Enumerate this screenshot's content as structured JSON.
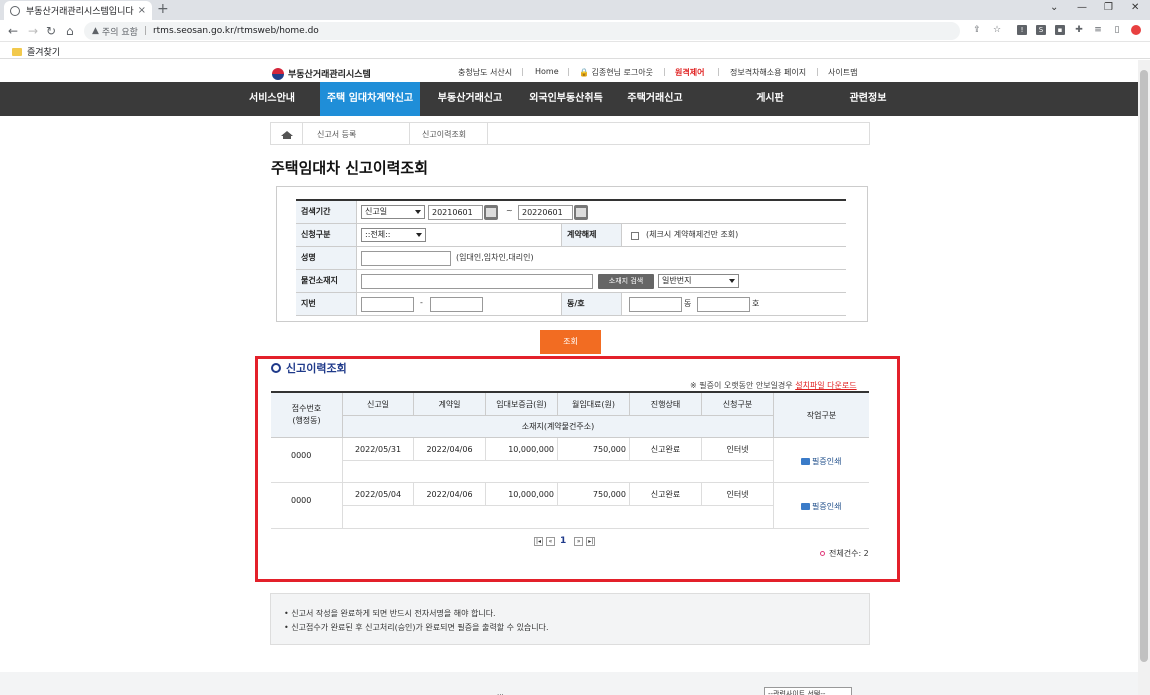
{
  "browser": {
    "tab_title": "부동산거래관리시스템입니다",
    "tab_close": "×",
    "new_tab": "+",
    "window_controls": [
      "⌄",
      "—",
      "❐",
      "✕"
    ],
    "security_label": "주의 요함",
    "url": "rtms.seosan.go.kr/rtmsweb/home.do",
    "bookmark": "즐겨찾기"
  },
  "header": {
    "logo_text": "부동산거래관리시스템",
    "region": "충청남도 서산시",
    "home": "Home",
    "user": "김종현님 로그아웃",
    "remote": "원격제어",
    "info_page": "정보격차해소용 페이지",
    "sitemap": "사이트맵"
  },
  "gnb": [
    "서비스안내",
    "주택 임대차계약신고",
    "부동산거래신고",
    "외국인부동산취득",
    "주택거래신고",
    "게시판",
    "관련정보"
  ],
  "breadcrumb": [
    "신고서 등록",
    "신고이력조회"
  ],
  "page_title": "주택임대차 신고이력조회",
  "form": {
    "period_label": "검색기간",
    "period_type": "신고일",
    "date_from": "20210601",
    "tilde": "~",
    "date_to": "20220601",
    "apply_type_label": "신청구분",
    "apply_type_value": "::전체::",
    "cancel_label": "계약해제",
    "cancel_note": "(체크시 계약해제건만 조회)",
    "name_label": "성명",
    "name_note": "(임대인,임차인,대리인)",
    "address_label": "물건소재지",
    "address_search": "소재지 검색",
    "lot_type": "일반번지",
    "lot_label": "지번",
    "dash": "-",
    "dong_ho_label": "동/호",
    "dong_unit": "동",
    "ho_unit": "호"
  },
  "search_button": "조회",
  "results": {
    "title": "신고이력조회",
    "note_prefix": "※ 필증이 오랫동안 안보일경우",
    "note_link": "설치파일 다운로드",
    "headers": {
      "receipt_no": "접수번호\n(행정동)",
      "report_date": "신고일",
      "contract_date": "계약일",
      "deposit": "임대보증금(원)",
      "monthly": "월임대료(원)",
      "status": "진행상태",
      "apply_type": "신청구분",
      "address": "소재지(계약물건주소)",
      "action": "작업구분"
    },
    "rows": [
      {
        "receipt_no": "0000",
        "report_date": "2022/05/31",
        "contract_date": "2022/04/06",
        "deposit": "10,000,000",
        "monthly": "750,000",
        "status": "신고완료",
        "apply_type": "인터넷",
        "address": "",
        "action": "필증인쇄"
      },
      {
        "receipt_no": "0000",
        "report_date": "2022/05/04",
        "contract_date": "2022/04/06",
        "deposit": "10,000,000",
        "monthly": "750,000",
        "status": "신고완료",
        "apply_type": "인터넷",
        "address": "",
        "action": "필증인쇄"
      }
    ],
    "pager": {
      "current": "1"
    },
    "total": "전체건수: 2"
  },
  "info": [
    "• 신고서 작성을 완료하게 되면 반드시 전자서명을 해야 합니다.",
    "• 신고접수가 완료된 후 신고처리(승인)가 완료되면 필증을 출력할 수 있습니다."
  ],
  "footer": {
    "partial_text": "...",
    "related_sites": "--관련사이트 선택--"
  }
}
